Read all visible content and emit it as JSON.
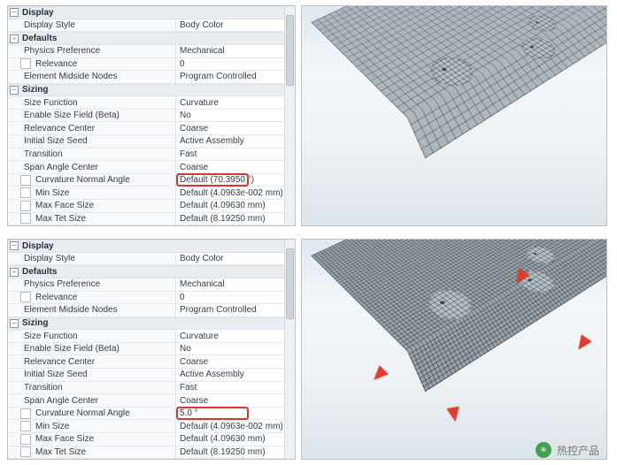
{
  "groups": {
    "display": "Display",
    "defaults": "Defaults",
    "sizing": "Sizing"
  },
  "common_rows": {
    "display_style": {
      "label": "Display Style",
      "value": "Body Color"
    },
    "physics_pref": {
      "label": "Physics Preference",
      "value": "Mechanical"
    },
    "relevance": {
      "label": "Relevance",
      "value": "0"
    },
    "elem_midside": {
      "label": "Element Midside Nodes",
      "value": "Program Controlled"
    },
    "size_func": {
      "label": "Size Function",
      "value": "Curvature"
    },
    "enable_size_field": {
      "label": "Enable Size Field (Beta)",
      "value": "No"
    },
    "relevance_center": {
      "label": "Relevance Center",
      "value": "Coarse"
    },
    "initial_seed": {
      "label": "Initial Size Seed",
      "value": "Active Assembly"
    },
    "transition": {
      "label": "Transition",
      "value": "Fast"
    },
    "span_angle": {
      "label": "Span Angle Center",
      "value": "Coarse"
    },
    "min_size": {
      "label": "Min Size",
      "value": "Default (4.0963e-002 mm)"
    },
    "max_face": {
      "label": "Max Face Size",
      "value": "Default (4.09630 mm)"
    },
    "max_tet": {
      "label": "Max Tet Size",
      "value": "Default (8.19250 mm)"
    },
    "curv_normal_label": "Curvature Normal Angle"
  },
  "top": {
    "curv_normal_value": "Default (70.3950 °)"
  },
  "bottom": {
    "curv_normal_value": "5.0 °"
  },
  "watermark": {
    "text": "热控产品"
  }
}
